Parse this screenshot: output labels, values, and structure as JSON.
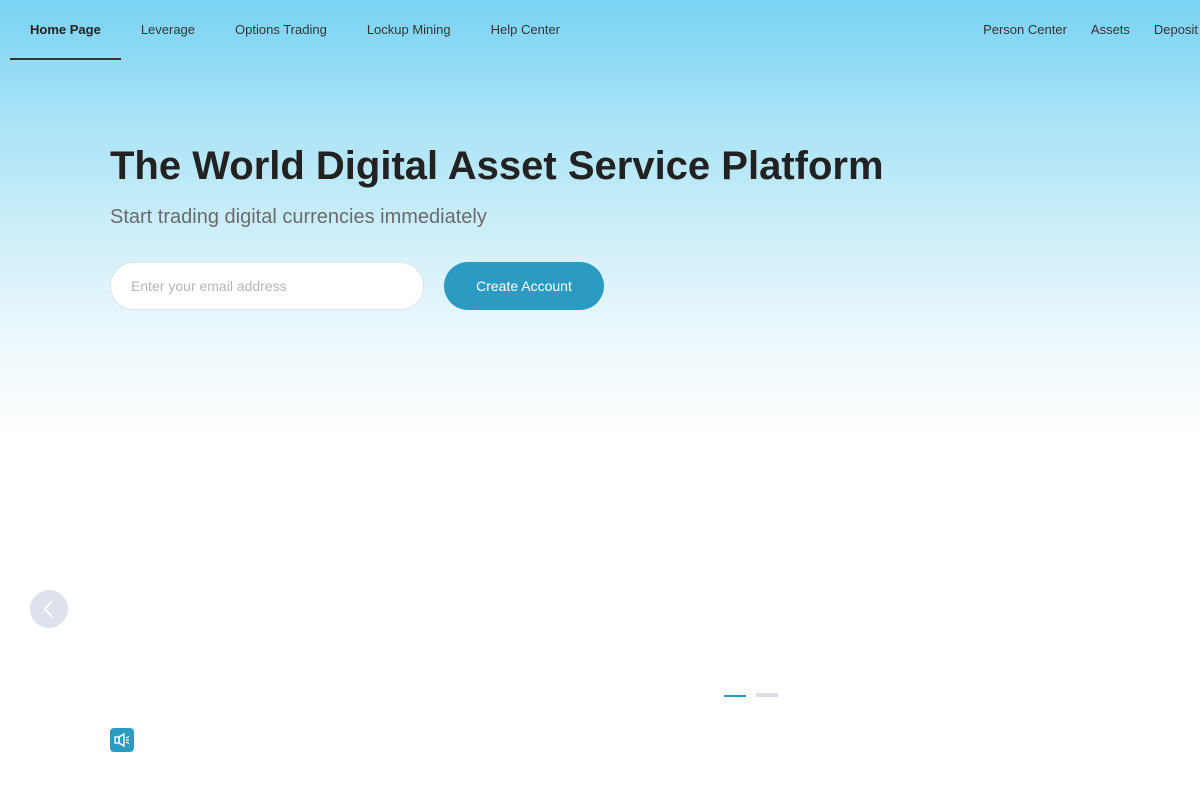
{
  "nav": {
    "left": [
      {
        "label": "Home Page",
        "active": true
      },
      {
        "label": "Leverage",
        "active": false
      },
      {
        "label": "Options Trading",
        "active": false
      },
      {
        "label": "Lockup Mining",
        "active": false
      },
      {
        "label": "Help Center",
        "active": false
      }
    ],
    "right": [
      {
        "label": "Person Center"
      },
      {
        "label": "Assets"
      },
      {
        "label": "Deposit"
      }
    ]
  },
  "hero": {
    "title": "The World Digital Asset Service Platform",
    "subtitle": "Start trading digital currencies immediately",
    "email_placeholder": "Enter your email address",
    "email_value": "",
    "cta_label": "Create Account"
  },
  "carousel": {
    "prev_icon": "chevron-left-icon",
    "slide_count": 2,
    "active_slide": 1
  },
  "notice": {
    "icon": "speaker-icon"
  },
  "colors": {
    "accent": "#2b9bc2",
    "sky_top": "#78d3f3",
    "text_dark": "#222222",
    "text_muted": "#6b6b6b"
  }
}
